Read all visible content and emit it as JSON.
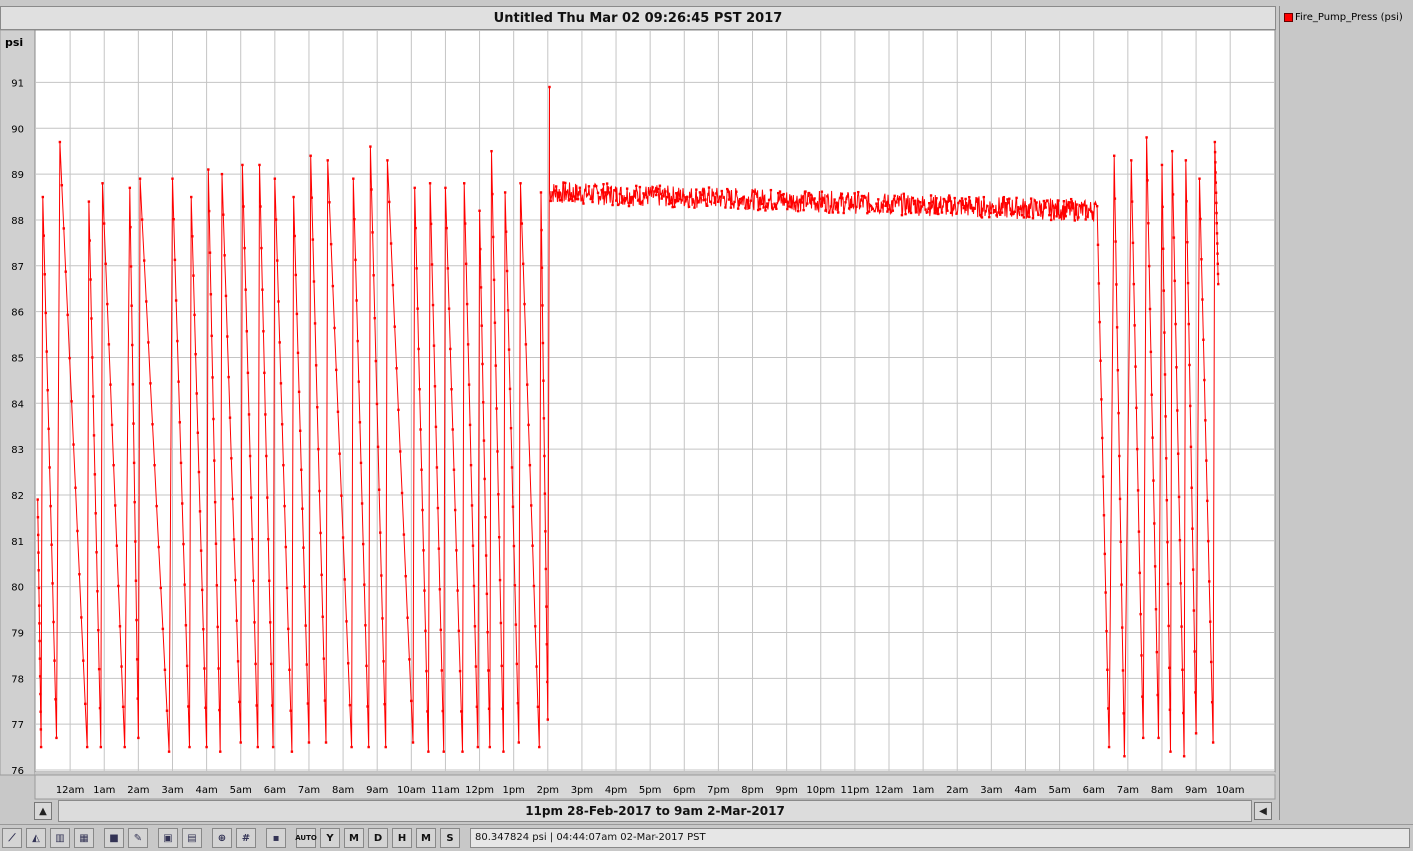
{
  "window": {
    "title": "Untitled Thu Mar 02 09:26:45 PST 2017"
  },
  "legend": {
    "entries": [
      {
        "label": "Fire_Pump_Press (psi)",
        "color": "#ff0000"
      }
    ]
  },
  "range": {
    "label": "11pm 28-Feb-2017 to 9am 2-Mar-2017"
  },
  "status": {
    "text": "80.347824 psi | 04:44:07am 02-Mar-2017 PST"
  },
  "toolbar": {
    "buttons": [
      {
        "name": "line-chart-icon",
        "label": ""
      },
      {
        "name": "area-chart-icon",
        "label": ""
      },
      {
        "name": "bar-chart-icon",
        "label": ""
      },
      {
        "name": "multi-chart-icon",
        "label": ""
      },
      {
        "name": "cube-icon",
        "label": ""
      },
      {
        "name": "brush-icon",
        "label": ""
      },
      {
        "name": "window-icon",
        "label": ""
      },
      {
        "name": "tile-icon",
        "label": ""
      },
      {
        "name": "zoom-icon",
        "label": ""
      },
      {
        "name": "grid-icon",
        "label": ""
      },
      {
        "name": "save-icon",
        "label": ""
      },
      {
        "name": "auto-button",
        "label": "AUTO"
      },
      {
        "name": "year-button",
        "label": "Y"
      },
      {
        "name": "month-button",
        "label": "M"
      },
      {
        "name": "day-button",
        "label": "D"
      },
      {
        "name": "hour-button",
        "label": "H"
      },
      {
        "name": "minute-button",
        "label": "M"
      },
      {
        "name": "second-button",
        "label": "S"
      }
    ]
  },
  "chart_data": {
    "type": "line",
    "title": "",
    "ylabel": "psi",
    "ylim": [
      76,
      91.5
    ],
    "yticks": [
      76,
      77,
      78,
      79,
      80,
      81,
      82,
      83,
      84,
      85,
      86,
      87,
      88,
      89,
      90,
      91
    ],
    "xlim_hours": [
      0,
      34
    ],
    "xticks": [
      {
        "h": 1,
        "label": "12am"
      },
      {
        "h": 2,
        "label": "1am"
      },
      {
        "h": 3,
        "label": "2am"
      },
      {
        "h": 4,
        "label": "3am"
      },
      {
        "h": 5,
        "label": "4am"
      },
      {
        "h": 6,
        "label": "5am"
      },
      {
        "h": 7,
        "label": "6am"
      },
      {
        "h": 8,
        "label": "7am"
      },
      {
        "h": 9,
        "label": "8am"
      },
      {
        "h": 10,
        "label": "9am"
      },
      {
        "h": 11,
        "label": "10am"
      },
      {
        "h": 12,
        "label": "11am"
      },
      {
        "h": 13,
        "label": "12pm"
      },
      {
        "h": 14,
        "label": "1pm"
      },
      {
        "h": 15,
        "label": "2pm"
      },
      {
        "h": 16,
        "label": "3pm"
      },
      {
        "h": 17,
        "label": "4pm"
      },
      {
        "h": 18,
        "label": "5pm"
      },
      {
        "h": 19,
        "label": "6pm"
      },
      {
        "h": 20,
        "label": "7pm"
      },
      {
        "h": 21,
        "label": "8pm"
      },
      {
        "h": 22,
        "label": "9pm"
      },
      {
        "h": 23,
        "label": "10pm"
      },
      {
        "h": 24,
        "label": "11pm"
      },
      {
        "h": 25,
        "label": "12am"
      },
      {
        "h": 26,
        "label": "1am"
      },
      {
        "h": 27,
        "label": "2am"
      },
      {
        "h": 28,
        "label": "3am"
      },
      {
        "h": 29,
        "label": "4am"
      },
      {
        "h": 30,
        "label": "5am"
      },
      {
        "h": 31,
        "label": "6am"
      },
      {
        "h": 32,
        "label": "7am"
      },
      {
        "h": 33,
        "label": "8am"
      },
      {
        "h": 34,
        "label": "9am"
      },
      {
        "h": 35,
        "label": "10am"
      }
    ],
    "grid": true,
    "series": [
      {
        "name": "Fire_Pump_Press (psi)",
        "color": "#ff0000",
        "cycle_peaks": [
          [
            0.05,
            81.9
          ],
          [
            0.2,
            88.5
          ],
          [
            0.7,
            89.7
          ],
          [
            1.55,
            88.4
          ],
          [
            1.95,
            88.8
          ],
          [
            2.75,
            88.7
          ],
          [
            3.05,
            88.9
          ],
          [
            4.0,
            88.9
          ],
          [
            4.55,
            88.5
          ],
          [
            5.05,
            89.1
          ],
          [
            5.45,
            89.0
          ],
          [
            6.05,
            89.2
          ],
          [
            6.55,
            89.2
          ],
          [
            7.0,
            88.9
          ],
          [
            7.55,
            88.5
          ],
          [
            8.05,
            89.4
          ],
          [
            8.55,
            89.3
          ],
          [
            9.3,
            88.9
          ],
          [
            9.8,
            89.6
          ],
          [
            10.3,
            89.3
          ],
          [
            11.1,
            88.7
          ],
          [
            11.55,
            88.8
          ],
          [
            12.0,
            88.7
          ],
          [
            12.55,
            88.8
          ],
          [
            13.0,
            88.2
          ],
          [
            13.35,
            89.5
          ],
          [
            13.75,
            88.6
          ],
          [
            14.2,
            88.8
          ],
          [
            14.8,
            88.6
          ],
          [
            15.05,
            90.9
          ]
        ],
        "cycle_troughs": [
          [
            0.15,
            76.5
          ],
          [
            0.6,
            76.7
          ],
          [
            1.5,
            76.5
          ],
          [
            1.9,
            76.5
          ],
          [
            2.6,
            76.5
          ],
          [
            3.0,
            76.7
          ],
          [
            3.9,
            76.4
          ],
          [
            4.5,
            76.5
          ],
          [
            5.0,
            76.5
          ],
          [
            5.4,
            76.4
          ],
          [
            6.0,
            76.6
          ],
          [
            6.5,
            76.5
          ],
          [
            6.95,
            76.5
          ],
          [
            7.5,
            76.4
          ],
          [
            8.0,
            76.6
          ],
          [
            8.5,
            76.6
          ],
          [
            9.25,
            76.5
          ],
          [
            9.75,
            76.5
          ],
          [
            10.25,
            76.5
          ],
          [
            11.05,
            76.6
          ],
          [
            11.5,
            76.4
          ],
          [
            11.95,
            76.4
          ],
          [
            12.5,
            76.4
          ],
          [
            12.95,
            76.5
          ],
          [
            13.3,
            76.5
          ],
          [
            13.7,
            76.4
          ],
          [
            14.15,
            76.6
          ],
          [
            14.75,
            76.5
          ],
          [
            15.0,
            77.1
          ]
        ],
        "steady": {
          "start_h": 15.05,
          "end_h": 31.05,
          "start_psi": 88.6,
          "end_psi": 88.2,
          "noise": 0.3
        },
        "tail_peaks": [
          [
            31.1,
            88.3
          ],
          [
            31.6,
            89.4
          ],
          [
            32.1,
            89.3
          ],
          [
            32.55,
            89.8
          ],
          [
            33.0,
            89.2
          ],
          [
            33.3,
            89.5
          ],
          [
            33.7,
            89.3
          ],
          [
            34.1,
            88.9
          ],
          [
            34.55,
            89.7
          ]
        ],
        "tail_troughs": [
          [
            31.45,
            76.5
          ],
          [
            31.9,
            76.3
          ],
          [
            32.45,
            76.7
          ],
          [
            32.9,
            76.7
          ],
          [
            33.25,
            76.4
          ],
          [
            33.65,
            76.3
          ],
          [
            34.0,
            76.8
          ],
          [
            34.5,
            76.6
          ],
          [
            34.65,
            86.6
          ]
        ]
      }
    ]
  }
}
